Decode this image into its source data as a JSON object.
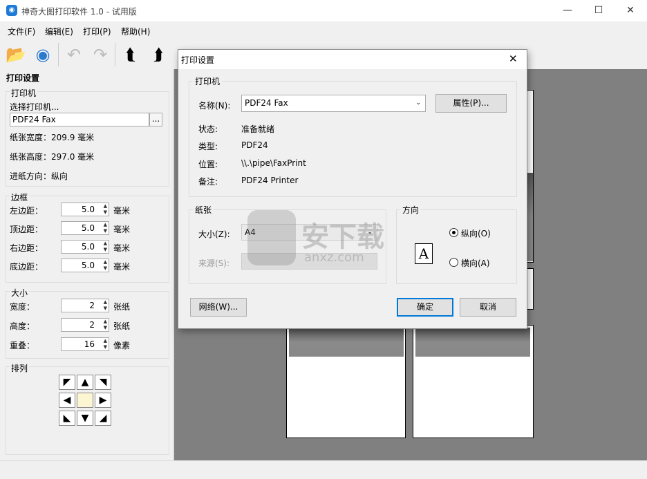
{
  "window": {
    "title": "神奇大图打印软件 1.0 - 试用版",
    "min": "—",
    "max": "☐",
    "close": "✕"
  },
  "menu": [
    "文件(F)",
    "编辑(E)",
    "打印(P)",
    "帮助(H)"
  ],
  "toolbar": {
    "icons": [
      "open-folder-icon",
      "webcam-icon",
      "undo-icon",
      "redo-icon",
      "rotate-left-icon",
      "rotate-right-icon",
      "flip-icon",
      "help-icon",
      "brush-icon",
      "print-preview-icon"
    ]
  },
  "left": {
    "title": "打印设置",
    "printer": {
      "legend": "打印机",
      "select_label": "选择打印机...",
      "value": "PDF24 Fax",
      "browse": "...",
      "width_label": "纸张宽度：",
      "width": "209.9 毫米",
      "height_label": "纸张高度：",
      "height": "297.0 毫米",
      "feed_label": "进纸方向：",
      "feed": "纵向"
    },
    "border": {
      "legend": "边框",
      "rows": [
        {
          "label": "左边距：",
          "value": "5.0",
          "unit": "毫米"
        },
        {
          "label": "顶边距：",
          "value": "5.0",
          "unit": "毫米"
        },
        {
          "label": "右边距：",
          "value": "5.0",
          "unit": "毫米"
        },
        {
          "label": "底边距：",
          "value": "5.0",
          "unit": "毫米"
        }
      ]
    },
    "size": {
      "legend": "大小",
      "rows": [
        {
          "label": "宽度：",
          "value": "2",
          "unit": "张纸"
        },
        {
          "label": "高度：",
          "value": "2",
          "unit": "张纸"
        },
        {
          "label": "重叠：",
          "value": "16",
          "unit": "像素"
        }
      ]
    },
    "arrange": {
      "legend": "排列",
      "arrows": [
        "◤",
        "▲",
        "◥",
        "◀",
        "",
        "▶",
        "◣",
        "▼",
        "◢"
      ]
    }
  },
  "dialog": {
    "title": "打印设置",
    "close": "✕",
    "printer_legend": "打印机",
    "name_label": "名称(N):",
    "name_value": "PDF24 Fax",
    "props_button": "属性(P)...",
    "status_label": "状态:",
    "status_value": "准备就绪",
    "type_label": "类型:",
    "type_value": "PDF24",
    "where_label": "位置:",
    "where_value": "\\\\.\\pipe\\FaxPrint",
    "comment_label": "备注:",
    "comment_value": "PDF24 Printer",
    "paper_legend": "纸张",
    "size_label": "大小(Z):",
    "size_value": "A4",
    "source_label": "来源(S):",
    "source_value": "",
    "orient_legend": "方向",
    "portrait": "纵向(O)",
    "landscape": "横向(A)",
    "orient_glyph": "A",
    "network_button": "网络(W)...",
    "ok_button": "确定",
    "cancel_button": "取消"
  },
  "watermark": {
    "text": "安下载",
    "sub": "anxz.com"
  }
}
